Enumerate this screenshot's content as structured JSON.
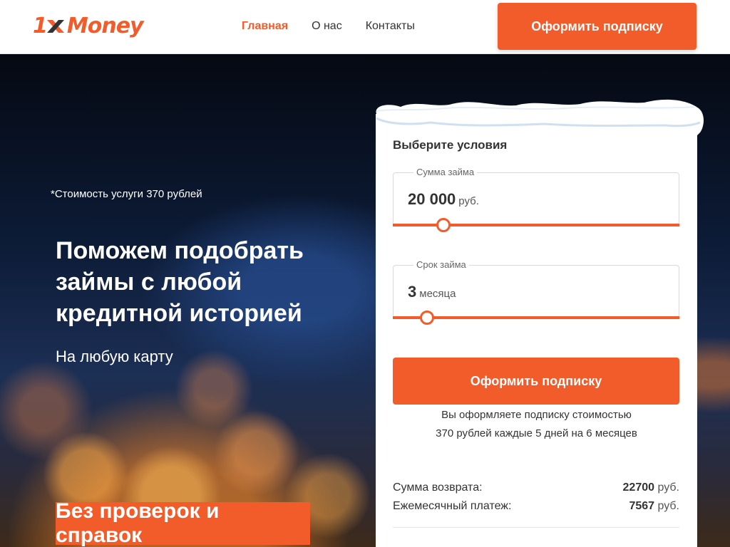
{
  "brand": {
    "logo_number": "1",
    "logo_word": "Money",
    "accent_color": "#f25c2a"
  },
  "nav": {
    "items": [
      {
        "label": "Главная",
        "active": true
      },
      {
        "label": "О нас",
        "active": false
      },
      {
        "label": "Контакты",
        "active": false
      }
    ]
  },
  "header": {
    "cta_label": "Оформить подписку"
  },
  "hero": {
    "price_note": "*Стоимость услуги 370 рублей",
    "title": "Поможем подобрать займы с любой кредитной историей",
    "subtitle": "На любую карту",
    "badge": "Без проверок и справок"
  },
  "form": {
    "title": "Выберите условия",
    "amount": {
      "legend": "Сумма займа",
      "value": "20 000",
      "unit": "руб.",
      "slider_fraction": 0.16
    },
    "term": {
      "legend": "Срок займа",
      "value": "3",
      "unit": "месяца",
      "slider_fraction": 0.1
    },
    "submit_label": "Оформить подписку",
    "subscription_note_1": "Вы оформляете подписку стоимостью",
    "subscription_note_2": "370 рублей каждые 5 дней на 6 месяцев",
    "summary": {
      "return_label": "Сумма возврата:",
      "return_value": "22700",
      "return_unit": "руб.",
      "monthly_label": "Ежемесячный платеж:",
      "monthly_value": "7567",
      "monthly_unit": "руб."
    }
  }
}
